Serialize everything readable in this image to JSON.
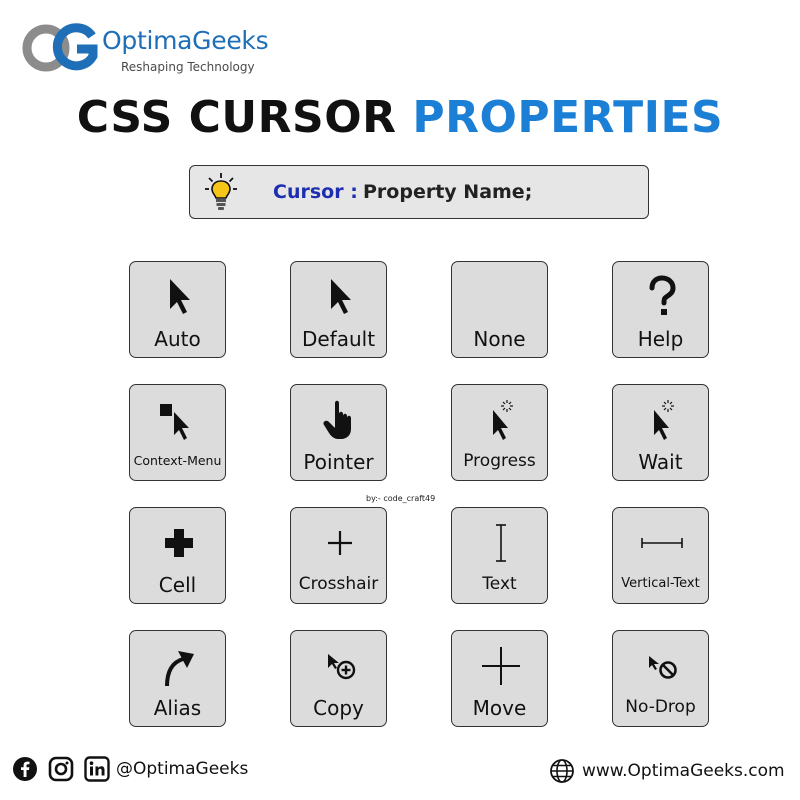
{
  "brand": {
    "name_part1": "Optima",
    "name_part2": "Geeks",
    "tagline": "Reshaping Technology"
  },
  "title": {
    "part1": "CSS CURSOR ",
    "part2": "PROPERTIES"
  },
  "syntax": {
    "keyword": "Cursor :",
    "property": "Property Name;"
  },
  "colors": {
    "accent_blue": "#1c7fd6",
    "keyword_blue": "#1d2fb0",
    "card_bg": "#dcdcdc",
    "bulb": "#f5c518"
  },
  "cursors": [
    {
      "label": "Auto",
      "icon": "arrow-cursor-icon"
    },
    {
      "label": "Default",
      "icon": "arrow-cursor-icon"
    },
    {
      "label": "None",
      "icon": ""
    },
    {
      "label": "Help",
      "icon": "question-mark-icon"
    },
    {
      "label": "Context-Menu",
      "icon": "context-menu-cursor-icon"
    },
    {
      "label": "Pointer",
      "icon": "hand-pointer-icon"
    },
    {
      "label": "Progress",
      "icon": "progress-cursor-icon"
    },
    {
      "label": "Wait",
      "icon": "wait-cursor-icon"
    },
    {
      "label": "Cell",
      "icon": "thick-plus-icon"
    },
    {
      "label": "Crosshair",
      "icon": "crosshair-icon"
    },
    {
      "label": "Text",
      "icon": "i-beam-icon"
    },
    {
      "label": "Vertical-Text",
      "icon": "horizontal-i-beam-icon"
    },
    {
      "label": "Alias",
      "icon": "curved-arrow-icon"
    },
    {
      "label": "Copy",
      "icon": "copy-cursor-icon"
    },
    {
      "label": "Move",
      "icon": "move-cross-icon"
    },
    {
      "label": "No-Drop",
      "icon": "no-drop-cursor-icon"
    }
  ],
  "credit": "by:- code_craft49",
  "footer": {
    "social": [
      "facebook-icon",
      "instagram-icon",
      "linkedin-icon"
    ],
    "handle": "@OptimaGeeks",
    "website": "www.OptimaGeeks.com"
  }
}
